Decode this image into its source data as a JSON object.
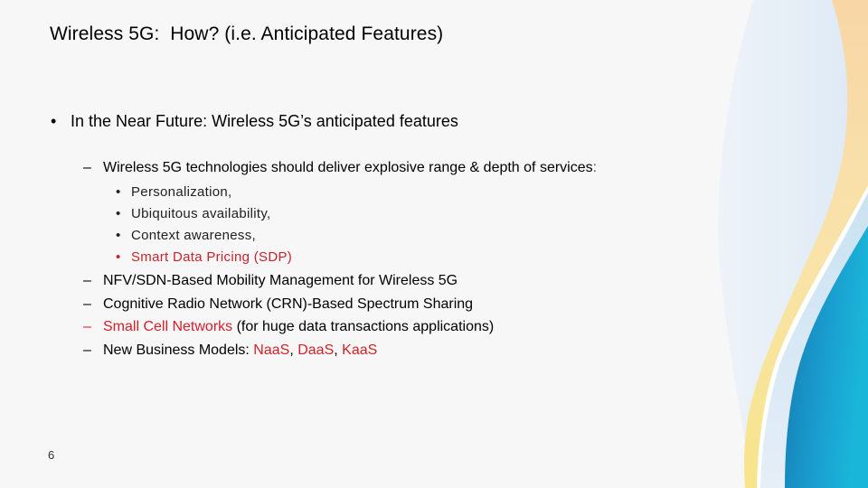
{
  "slide": {
    "title": "Wireless 5G:  How? (i.e. Anticipated Features)",
    "page_number": "6",
    "colors": {
      "text": "#000000",
      "highlight_red": "#d4202a",
      "background": "#f7f7f7",
      "wave_light_blue": "#dfeaf5",
      "wave_peach": "#f8d8a8",
      "wave_yellow": "#f9e38f",
      "wave_teal": "#1a9cc9"
    },
    "bullet_main": {
      "marker": "•",
      "text": "In the Near Future: Wireless 5G’s anticipated features"
    },
    "sub_intro": {
      "marker": "–",
      "text": "Wireless 5G technologies should deliver explosive range & depth of services",
      "suffix": ":"
    },
    "services": [
      {
        "marker": "•",
        "text": "Personalization,",
        "highlight": false
      },
      {
        "marker": "•",
        "text": "Ubiquitous availability,",
        "highlight": false
      },
      {
        "marker": "•",
        "text": "Context awareness,",
        "highlight": false
      },
      {
        "marker": "•",
        "text": "Smart Data Pricing (SDP)",
        "highlight": true
      }
    ],
    "features": [
      {
        "marker": "–",
        "text": "NFV/SDN-Based Mobility Management for Wireless 5G"
      },
      {
        "marker": "–",
        "text": "Cognitive Radio Network (CRN)-Based Spectrum Sharing"
      },
      {
        "marker": "–",
        "highlight_text": "Small Cell Networks",
        "text": " (for huge data transactions applications)"
      },
      {
        "marker": "–",
        "text": "New Business Models: ",
        "models": [
          "NaaS",
          "DaaS",
          "KaaS"
        ],
        "separator": ", "
      }
    ]
  }
}
